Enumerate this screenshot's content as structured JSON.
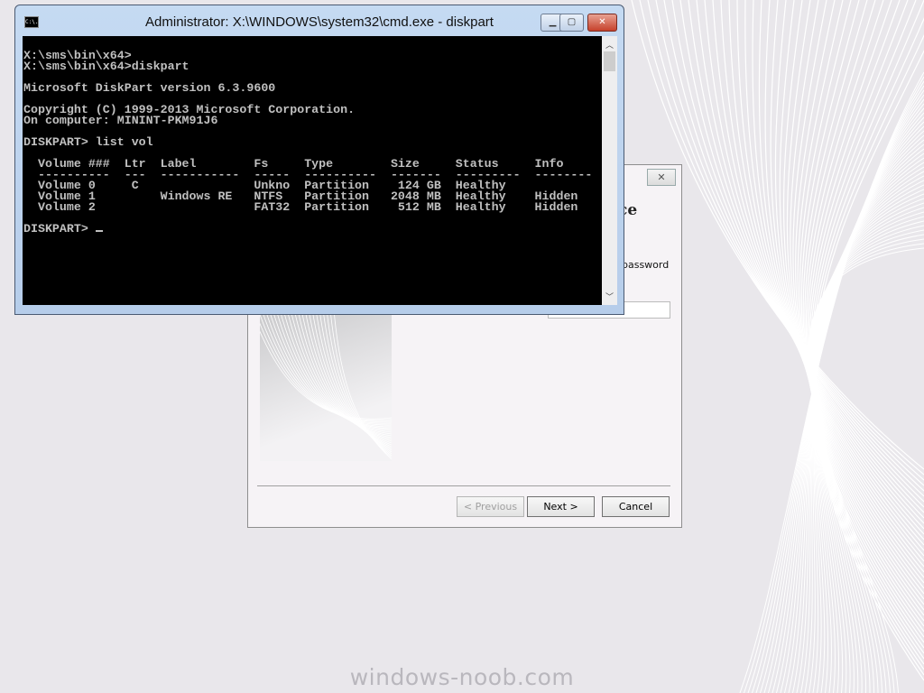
{
  "watermark": "windows-noob.com",
  "wizard": {
    "close_label": "✕",
    "heading_fragment": "ce",
    "password_fragment": "password",
    "buttons": {
      "previous": "< Previous",
      "next": "Next >",
      "cancel": "Cancel"
    }
  },
  "console_window": {
    "title": "Administrator: X:\\WINDOWS\\system32\\cmd.exe - diskpart",
    "icon_label": "C:\\.",
    "controls": {
      "minimize": "▁",
      "maximize": "▢",
      "close": "✕"
    },
    "lines": [
      "X:\\sms\\bin\\x64>",
      "X:\\sms\\bin\\x64>diskpart",
      "",
      "Microsoft DiskPart version 6.3.9600",
      "",
      "Copyright (C) 1999-2013 Microsoft Corporation.",
      "On computer: MININT-PKM91J6",
      "",
      "DISKPART> list vol",
      "",
      "  Volume ###  Ltr  Label        Fs     Type        Size     Status     Info",
      "  ----------  ---  -----------  -----  ----------  -------  ---------  --------",
      "  Volume 0     C                Unkno  Partition    124 GB  Healthy",
      "  Volume 1         Windows RE   NTFS   Partition   2048 MB  Healthy    Hidden",
      "  Volume 2                      FAT32  Partition    512 MB  Healthy    Hidden",
      ""
    ],
    "prompt": "DISKPART> ",
    "volumes_table": {
      "columns": [
        "Volume ###",
        "Ltr",
        "Label",
        "Fs",
        "Type",
        "Size",
        "Status",
        "Info"
      ],
      "rows": [
        [
          "Volume 0",
          "C",
          "",
          "Unkno",
          "Partition",
          "124 GB",
          "Healthy",
          ""
        ],
        [
          "Volume 1",
          "",
          "Windows RE",
          "NTFS",
          "Partition",
          "2048 MB",
          "Healthy",
          "Hidden"
        ],
        [
          "Volume 2",
          "",
          "",
          "FAT32",
          "Partition",
          "512 MB",
          "Healthy",
          "Hidden"
        ]
      ]
    }
  },
  "colors": {
    "console_bg": "#000000",
    "console_text": "#c0c0c0",
    "titlebar": "#c5daf2",
    "close_button": "#c6412b"
  }
}
